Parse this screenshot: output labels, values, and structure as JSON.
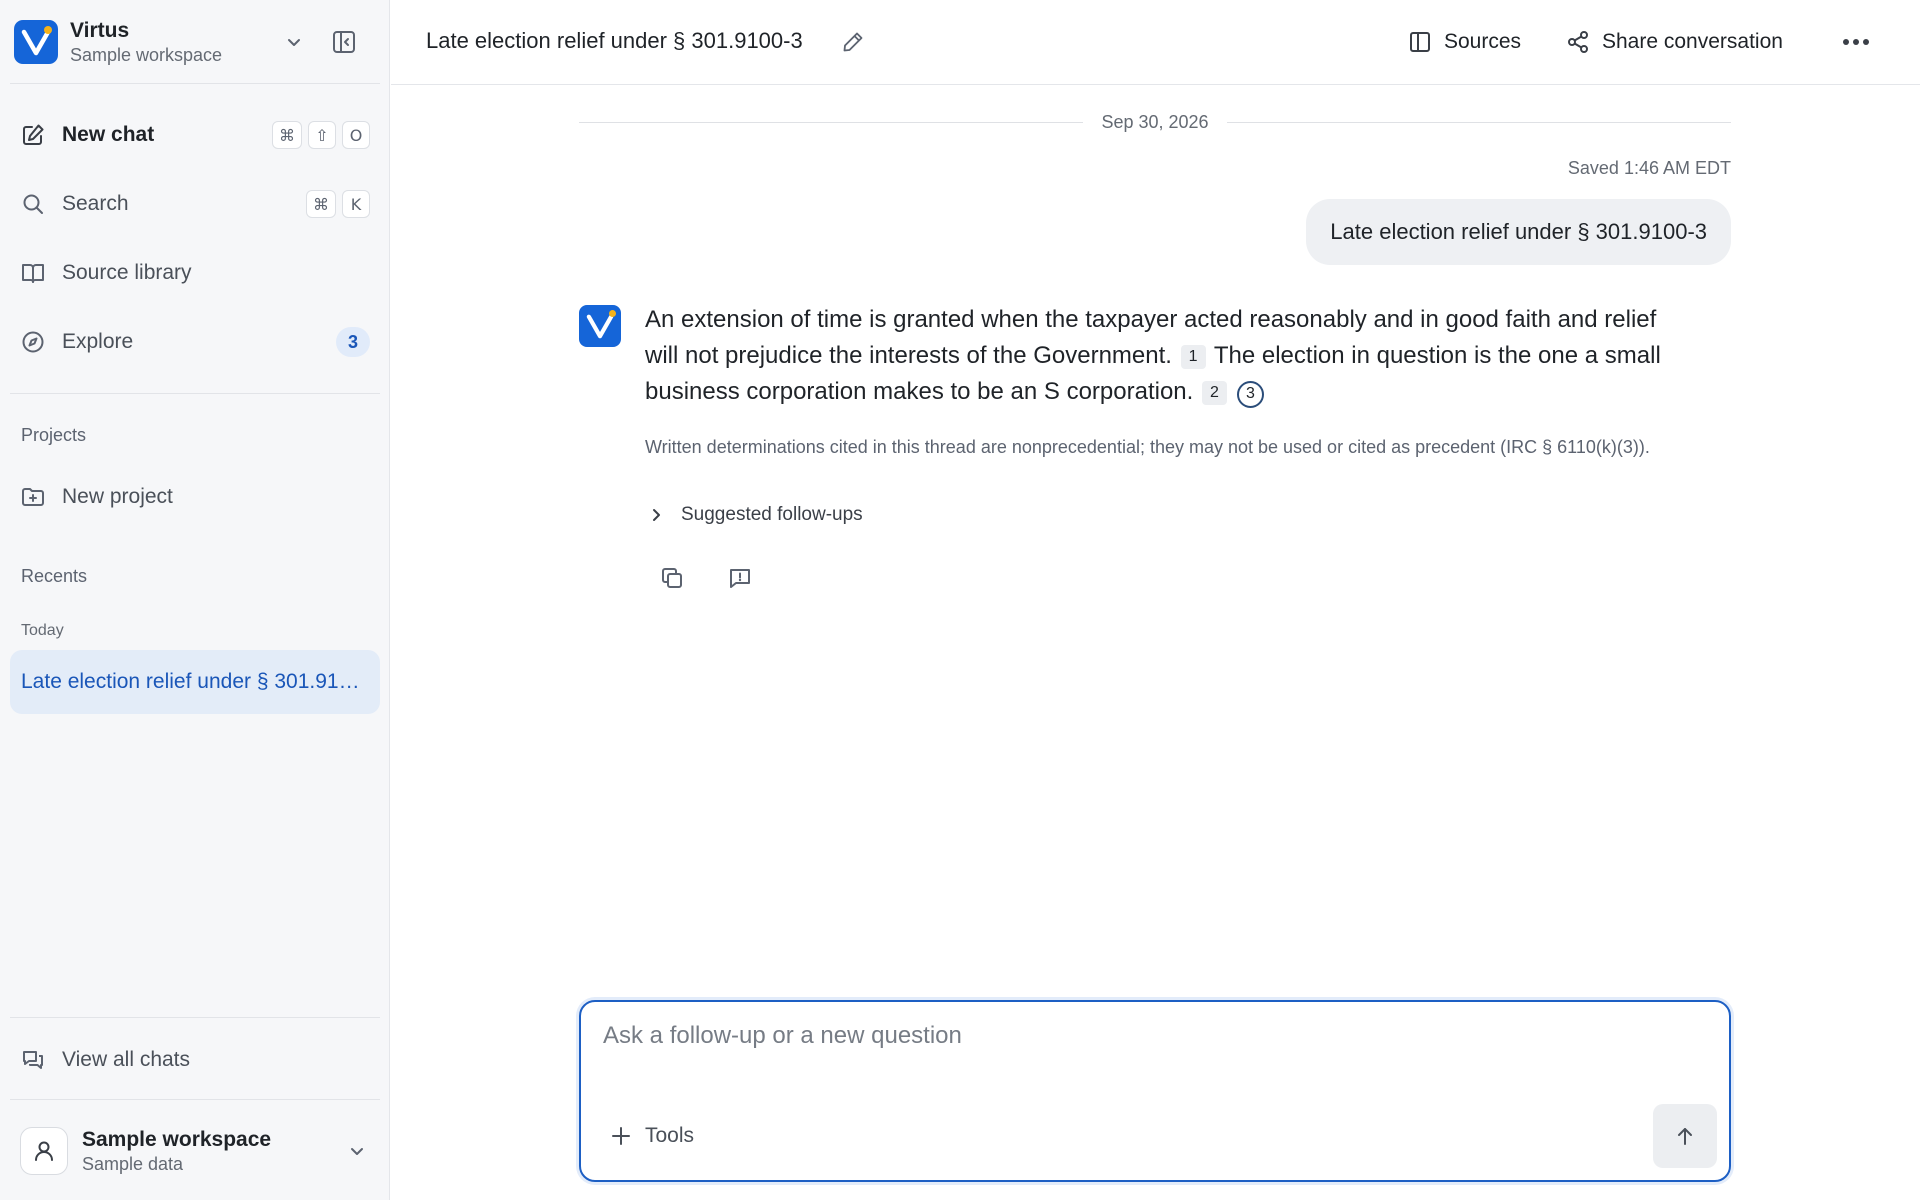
{
  "workspace": {
    "name": "Virtus",
    "subtitle": "Sample workspace"
  },
  "sidebar": {
    "nav": [
      {
        "label": "New chat",
        "icon": "compose-icon",
        "shortcut": [
          "⌘",
          "⇧",
          "O"
        ]
      },
      {
        "label": "Search",
        "icon": "search-icon",
        "shortcut": [
          "⌘",
          "K"
        ]
      },
      {
        "label": "Source library",
        "icon": "book-icon"
      },
      {
        "label": "Explore",
        "icon": "compass-icon",
        "badge": "3"
      }
    ],
    "projects_label": "Projects",
    "new_project_label": "New project",
    "recents_label": "Recents",
    "today_label": "Today",
    "recent_items": [
      "Late election relief under § 301.9100-3"
    ],
    "view_all_label": "View all chats",
    "user": {
      "name": "Sample workspace",
      "subtitle": "Sample data"
    }
  },
  "header": {
    "title": "Late election relief under § 301.9100-3",
    "sources_label": "Sources",
    "share_label": "Share conversation"
  },
  "conversation": {
    "date": "Sep 30, 2026",
    "saved": "Saved 1:46 AM EDT",
    "user_message": "Late election relief under § 301.9100-3",
    "answer": {
      "part1": "An extension of time is granted when the taxpayer acted reasonably and in good faith and relief will not prejudice the interests of the Government.",
      "cite1": "1",
      "part2": " The election in question is the one a small business corporation makes to be an S corporation.",
      "cite2": "2",
      "cite3": "3"
    },
    "disclaimer": "Written determinations cited in this thread are nonprecedential; they may not be used or cited as precedent (IRC § 6110(k)(3)).",
    "followups_label": "Suggested follow-ups"
  },
  "composer": {
    "placeholder": "Ask a follow-up or a new question",
    "tools_label": "Tools"
  },
  "colors": {
    "accent": "#1565d8",
    "logo_dot": "#f5b21a",
    "sidebar_bg": "#f6f7f9",
    "active_item_bg": "#e3ecf8"
  }
}
